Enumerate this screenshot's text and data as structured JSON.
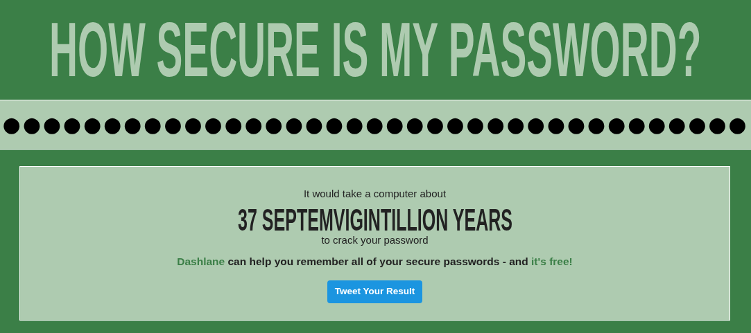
{
  "title": "HOW SECURE IS MY PASSWORD?",
  "password_field": {
    "value": "●●●●●●●●●●●●●●●●●●●●●●●●●●●●●●●●●●●●●"
  },
  "result": {
    "intro": "It would take a computer about",
    "duration": "37 SEPTEMVIGINTILLION YEARS",
    "outro": "to crack your password",
    "promo": [
      {
        "kind": "link",
        "text": "Dashlane"
      },
      {
        "kind": "plain",
        "text": "can help you remember all of your secure passwords - and"
      },
      {
        "kind": "link",
        "text": "it's free!"
      }
    ],
    "button": "Tweet Your Result"
  }
}
